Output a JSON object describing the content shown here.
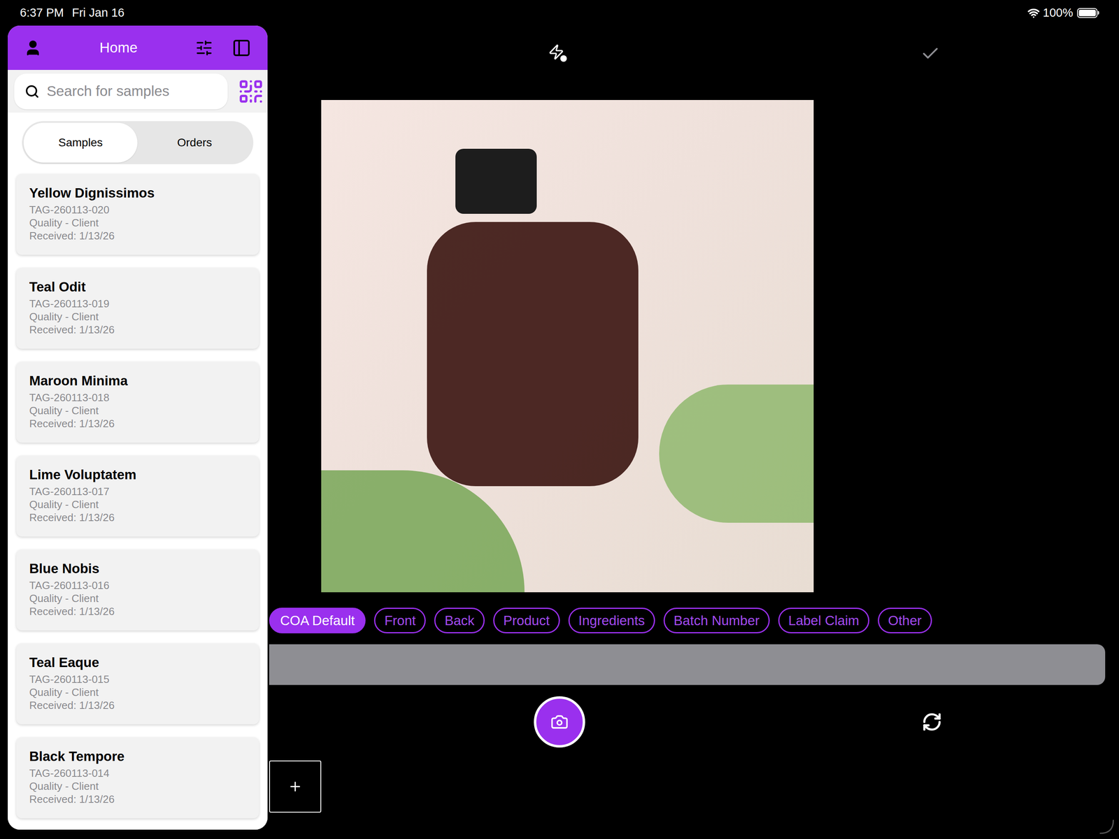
{
  "status_bar": {
    "time": "6:37 PM",
    "date": "Fri Jan 16",
    "battery": "100%",
    "battery_level": 1
  },
  "sidebar": {
    "title": "Home",
    "search": {
      "placeholder": "Search for samples"
    },
    "tabs": [
      {
        "label": "Samples",
        "selected": true
      },
      {
        "label": "Orders",
        "selected": false
      }
    ],
    "samples": [
      {
        "name": "Yellow Dignissimos",
        "tag": "TAG-260113-020",
        "type": "Quality - Client",
        "received": "Received: 1/13/26"
      },
      {
        "name": "Teal Odit",
        "tag": "TAG-260113-019",
        "type": "Quality - Client",
        "received": "Received: 1/13/26"
      },
      {
        "name": "Maroon Minima",
        "tag": "TAG-260113-018",
        "type": "Quality - Client",
        "received": "Received: 1/13/26"
      },
      {
        "name": "Lime Voluptatem",
        "tag": "TAG-260113-017",
        "type": "Quality - Client",
        "received": "Received: 1/13/26"
      },
      {
        "name": "Blue Nobis",
        "tag": "TAG-260113-016",
        "type": "Quality - Client",
        "received": "Received: 1/13/26"
      },
      {
        "name": "Teal Eaque",
        "tag": "TAG-260113-015",
        "type": "Quality - Client",
        "received": "Received: 1/13/26"
      },
      {
        "name": "Black Tempore",
        "tag": "TAG-260113-014",
        "type": "Quality - Client",
        "received": "Received: 1/13/26"
      }
    ]
  },
  "camera": {
    "tags": [
      {
        "label": "COA Default",
        "selected": true
      },
      {
        "label": "Front",
        "selected": false
      },
      {
        "label": "Back",
        "selected": false
      },
      {
        "label": "Product",
        "selected": false
      },
      {
        "label": "Ingredients",
        "selected": false
      },
      {
        "label": "Batch Number",
        "selected": false
      },
      {
        "label": "Label Claim",
        "selected": false
      },
      {
        "label": "Other",
        "selected": false
      }
    ]
  }
}
